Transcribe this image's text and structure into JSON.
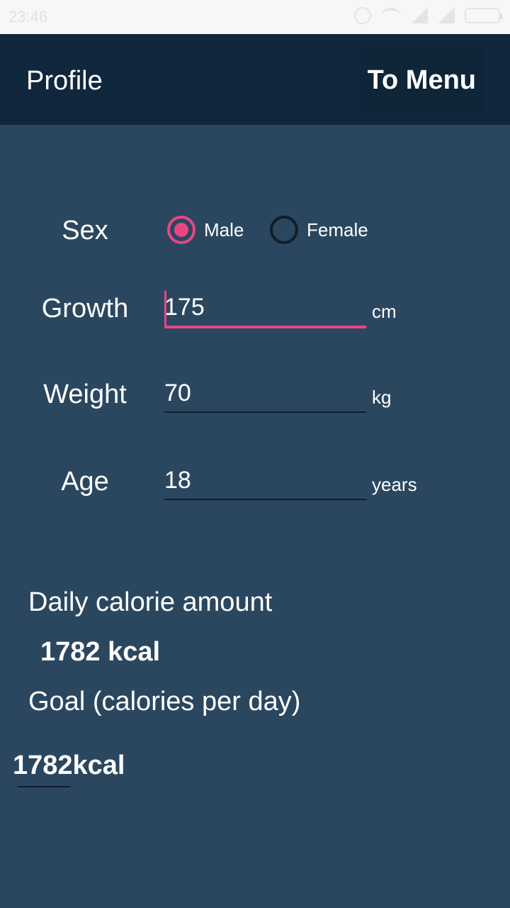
{
  "status_bar": {
    "time": "23:46",
    "icons": [
      "alarm-icon",
      "wifi-icon",
      "signal-icon",
      "signal-icon",
      "battery-icon"
    ]
  },
  "app_bar": {
    "title": "Profile",
    "menu_button_label": "To Menu"
  },
  "form": {
    "sex": {
      "label": "Sex",
      "options": [
        {
          "label": "Male",
          "selected": true
        },
        {
          "label": "Female",
          "selected": false
        }
      ]
    },
    "growth": {
      "label": "Growth",
      "value": "175",
      "unit": "cm"
    },
    "weight": {
      "label": "Weight",
      "value": "70",
      "unit": "kg"
    },
    "age": {
      "label": "Age",
      "value": "18",
      "unit": "years"
    }
  },
  "summary": {
    "daily_title": "Daily calorie amount",
    "daily_value": "1782 kcal",
    "goal_title": "Goal (calories per day)",
    "goal_value": "1782kcal"
  },
  "colors": {
    "accent": "#ea4582",
    "app_bar": "#10273d",
    "background": "#2b4760"
  }
}
